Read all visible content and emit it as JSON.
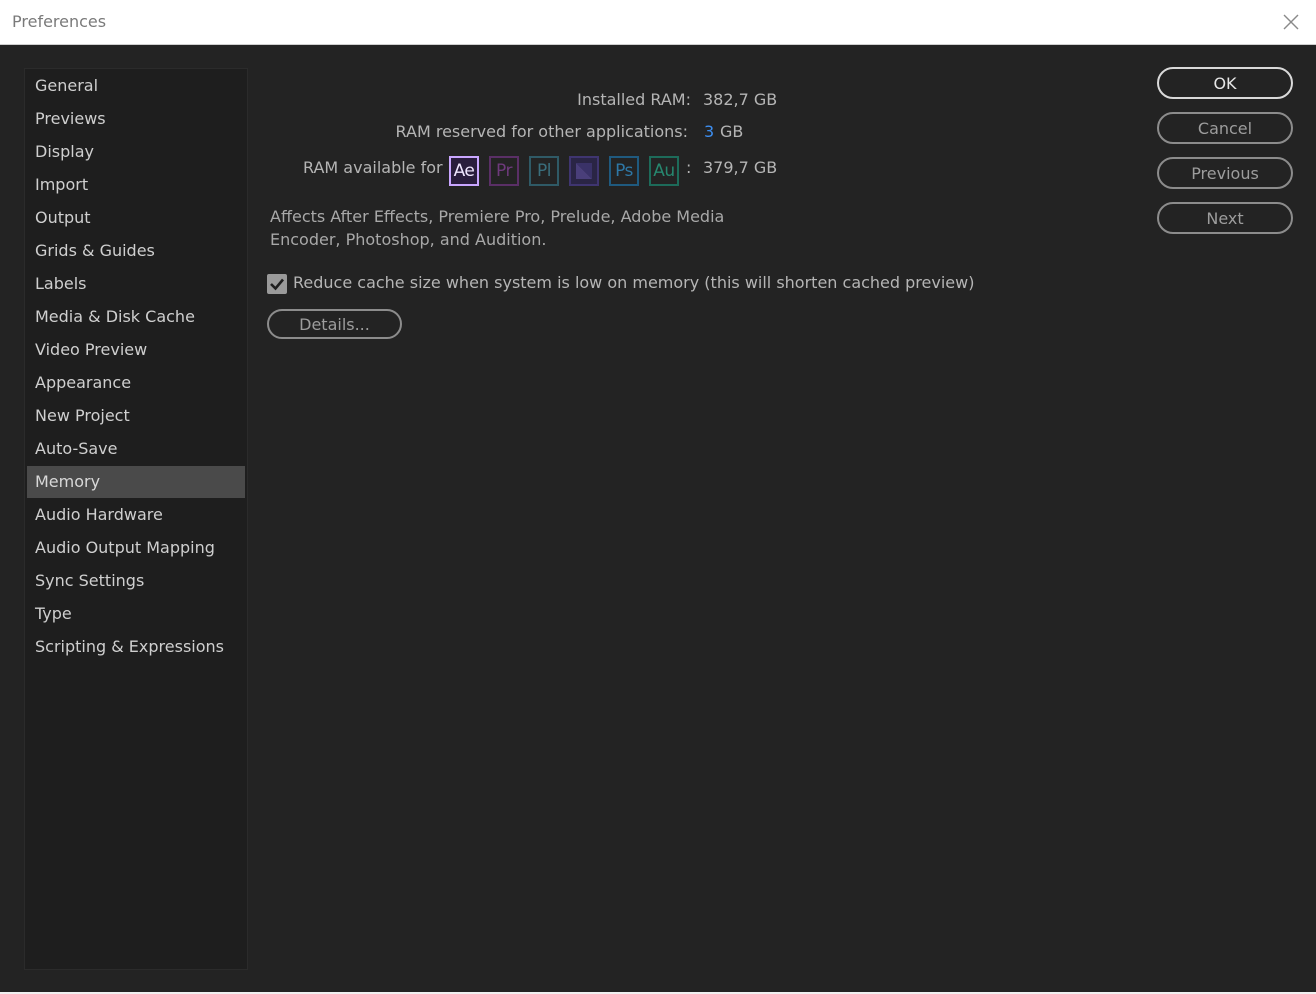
{
  "window": {
    "title": "Preferences",
    "close_icon": "close-icon"
  },
  "sidebar": {
    "items": [
      {
        "label": "General"
      },
      {
        "label": "Previews"
      },
      {
        "label": "Display"
      },
      {
        "label": "Import"
      },
      {
        "label": "Output"
      },
      {
        "label": "Grids & Guides"
      },
      {
        "label": "Labels"
      },
      {
        "label": "Media & Disk Cache"
      },
      {
        "label": "Video Preview"
      },
      {
        "label": "Appearance"
      },
      {
        "label": "New Project"
      },
      {
        "label": "Auto-Save"
      },
      {
        "label": "Memory",
        "selected": true
      },
      {
        "label": "Audio Hardware"
      },
      {
        "label": "Audio Output Mapping"
      },
      {
        "label": "Sync Settings"
      },
      {
        "label": "Type"
      },
      {
        "label": "Scripting & Expressions"
      }
    ]
  },
  "memory": {
    "installed_label": "Installed RAM:",
    "installed_value": "382,7 GB",
    "reserved_label": "RAM reserved for other applications:",
    "reserved_value": "3",
    "reserved_unit": "GB",
    "available_label": "RAM available for",
    "available_colon": ":",
    "available_value": "379,7 GB",
    "apps": [
      {
        "abbr": "Ae",
        "name": "After Effects",
        "color": "#c9a6ff",
        "active": true
      },
      {
        "abbr": "Pr",
        "name": "Premiere Pro",
        "color": "#6b3a7a",
        "active": false
      },
      {
        "abbr": "Pl",
        "name": "Prelude",
        "color": "#2f5a66",
        "active": false
      },
      {
        "abbr": "",
        "name": "Adobe Media Encoder",
        "color": "#4a3f7a",
        "active": false
      },
      {
        "abbr": "Ps",
        "name": "Photoshop",
        "color": "#1f5a7f",
        "active": false
      },
      {
        "abbr": "Au",
        "name": "Audition",
        "color": "#1d6b5a",
        "active": false
      }
    ],
    "description": "Affects After Effects, Premiere Pro, Prelude, Adobe Media Encoder, Photoshop, and Audition.",
    "reduce_cache_label": "Reduce cache size when system is low on memory (this will shorten cached preview)",
    "reduce_cache_checked": true,
    "details_label": "Details..."
  },
  "buttons": {
    "ok": "OK",
    "cancel": "Cancel",
    "previous": "Previous",
    "next": "Next"
  },
  "colors": {
    "background": "#232323",
    "selected_item": "#4a4a4a",
    "value_accent": "#3d8ef0"
  }
}
